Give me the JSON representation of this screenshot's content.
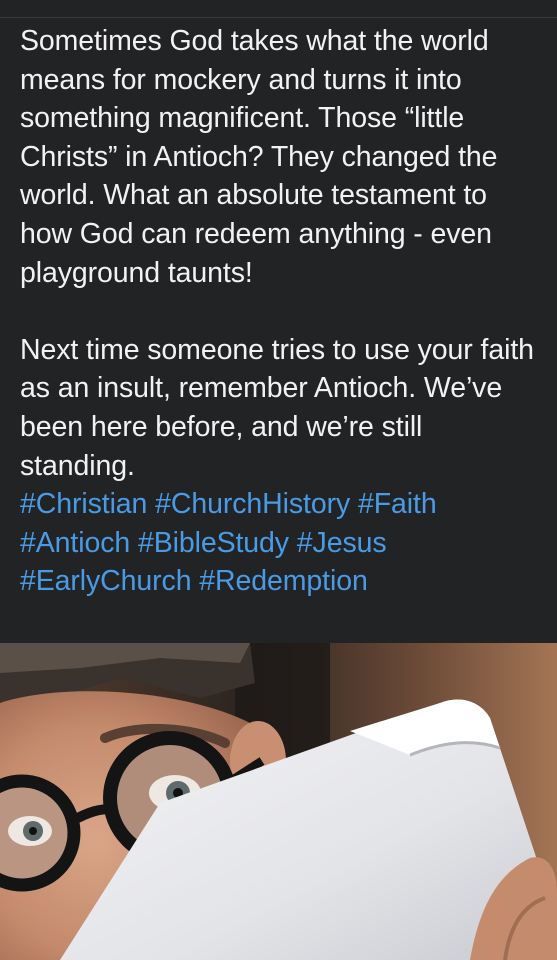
{
  "post": {
    "paragraph_1": "Sometimes God takes what the world means for mockery and turns it into something magnificent. Those “little Christs” in Antioch? They changed the world. What an absolute testament to how God can redeem anything - even playground taunts!",
    "paragraph_2": "Next time someone tries to use your faith as an insult, remember Antioch. We’ve been here before, and we’re still standing.",
    "hashtags": [
      "#Christian",
      "#ChurchHistory",
      "#Faith",
      "#Antioch",
      "#BibleStudy",
      "#Jesus",
      "#EarlyChurch",
      "#Redemption"
    ]
  },
  "colors": {
    "background": "#222325",
    "text": "#f2f2f2",
    "hashtag": "#4a9be6"
  }
}
